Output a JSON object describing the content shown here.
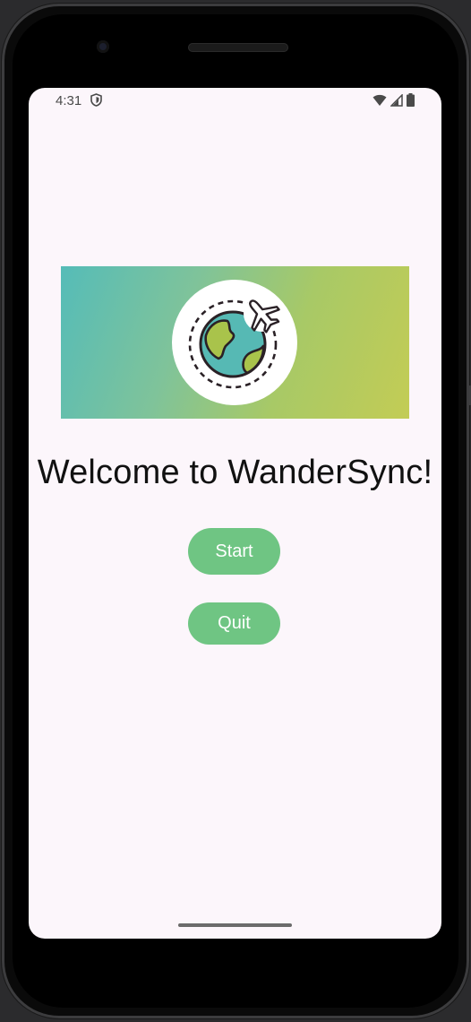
{
  "status_bar": {
    "time": "4:31",
    "icons": [
      "shield-icon",
      "wifi-icon",
      "signal-icon",
      "battery-icon"
    ]
  },
  "banner": {
    "icon": "globe-airplane-icon",
    "gradient_colors": [
      "#55bcb8",
      "#c3cc55"
    ]
  },
  "welcome": {
    "title": "Welcome to WanderSync!"
  },
  "buttons": {
    "start_label": "Start",
    "quit_label": "Quit",
    "color": "#6fc583"
  }
}
